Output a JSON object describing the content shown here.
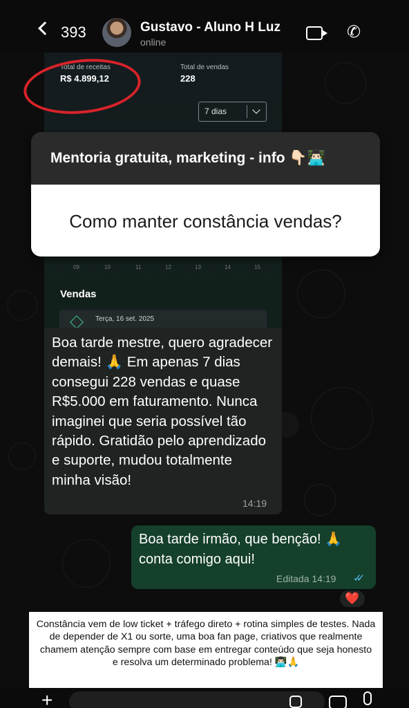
{
  "header": {
    "unread_count": "393",
    "contact_name": "Gustavo - Aluno H Luz",
    "contact_status": "online"
  },
  "dashboard": {
    "revenue_label": "Total de receitas",
    "revenue_value": "R$ 4.899,12",
    "sales_label": "Total de vendas",
    "sales_value": "228",
    "period": "7 dias",
    "axis_ticks": [
      "09",
      "10",
      "11",
      "12",
      "13",
      "14",
      "15"
    ],
    "sales_section": "Vendas",
    "sale_date": "Terça, 16 set. 2025"
  },
  "story": {
    "title": "Mentoria gratuita, marketing - info 👇🏻👨🏻‍💻",
    "question": "Como manter constância vendas?"
  },
  "incoming": {
    "text": "Boa tarde mestre, quero agradecer demais! 🙏 Em apenas 7 dias consegui 228 vendas e quase R$5.000 em faturamento. Nunca imaginei que seria possível tão rápido. Gratidão pelo aprendizado e suporte, mudou totalmente minha visão!",
    "time": "14:19"
  },
  "outgoing": {
    "text": "Boa tarde irmão, que benção! 🙏 conta comigo aqui!",
    "status": "Editada 14:19",
    "reaction": "❤️"
  },
  "caption": {
    "text": "Constância vem de low ticket + tráfego direto + rotina simples de testes. Nada de depender de X1 ou sorte, uma boa fan page, criativos que realmente chamem atenção sempre com base em entregar conteúdo que seja honesto e resolva um determinado problema! 👨🏻‍💻🙏"
  }
}
